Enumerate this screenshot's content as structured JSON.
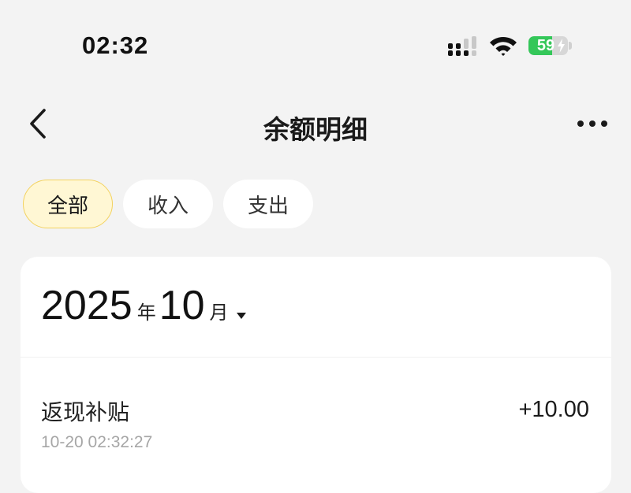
{
  "status_bar": {
    "time": "02:32",
    "battery_level": "59",
    "battery_fraction": 0.59,
    "battery_color": "#34c759",
    "signal_icon": "cellular-signal-icon",
    "wifi_icon": "wifi-icon"
  },
  "nav": {
    "title": "余额明细",
    "back_icon": "chevron-left-icon",
    "more_icon": "more-dots-icon"
  },
  "tabs": [
    {
      "label": "全部",
      "active": true
    },
    {
      "label": "收入",
      "active": false
    },
    {
      "label": "支出",
      "active": false
    }
  ],
  "accent_color": "#f3d25f",
  "month_filter": {
    "year": "2025",
    "year_unit": "年",
    "month": "10",
    "month_unit": "月",
    "caret_icon": "caret-down-icon"
  },
  "records": [
    {
      "title": "返现补贴",
      "time": "10-20 02:32:27",
      "amount": "+10.00"
    }
  ]
}
